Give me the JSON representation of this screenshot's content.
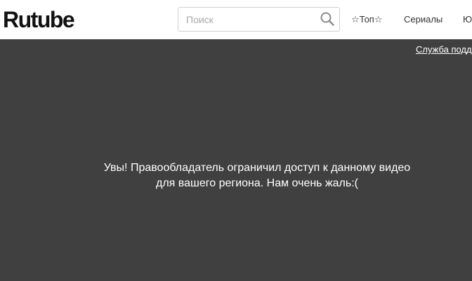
{
  "header": {
    "logo_text": "Rutube",
    "search": {
      "placeholder": "Поиск",
      "value": "",
      "icon": "search-icon"
    },
    "nav": {
      "top_label": "☆Топ☆",
      "series_label": "Сериалы",
      "more_label": "Ю"
    }
  },
  "player": {
    "support_link": "Служба поддержки",
    "message": "Увы! Правообладатель ограничил доступ к данному видео для вашего региона. Нам очень жаль:(",
    "background_color": "#404040"
  }
}
